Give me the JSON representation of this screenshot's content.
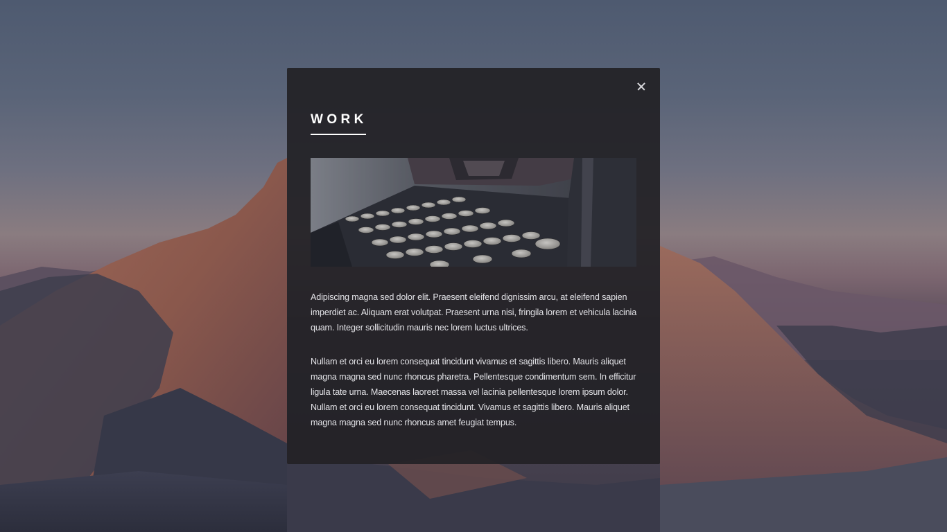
{
  "background": {
    "description_icon": "mountain-landscape-image",
    "colors": {
      "sky_top": "#4e5a70",
      "sky_dusk": "#8a7c80",
      "rock": "#8c5a4e",
      "shadow": "#323240"
    }
  },
  "modal": {
    "title": "WORK",
    "close_icon": "close-icon",
    "image_icon": "typewriter-image",
    "paragraphs": [
      "Adipiscing magna sed dolor elit. Praesent eleifend dignissim arcu, at eleifend sapien imperdiet ac. Aliquam erat volutpat. Praesent urna nisi, fringila lorem et vehicula lacinia quam. Integer sollicitudin mauris nec lorem luctus ultrices.",
      "Nullam et orci eu lorem consequat tincidunt vivamus et sagittis libero. Mauris aliquet magna magna sed nunc rhoncus pharetra. Pellentesque condimentum sem. In efficitur ligula tate urna. Maecenas laoreet massa vel lacinia pellentesque lorem ipsum dolor. Nullam et orci eu lorem consequat tincidunt. Vivamus et sagittis libero. Mauris aliquet magna magna sed nunc rhoncus amet feugiat tempus."
    ],
    "colors": {
      "panel": "#222126",
      "text": "#e4e4e8",
      "title": "#ffffff"
    }
  }
}
